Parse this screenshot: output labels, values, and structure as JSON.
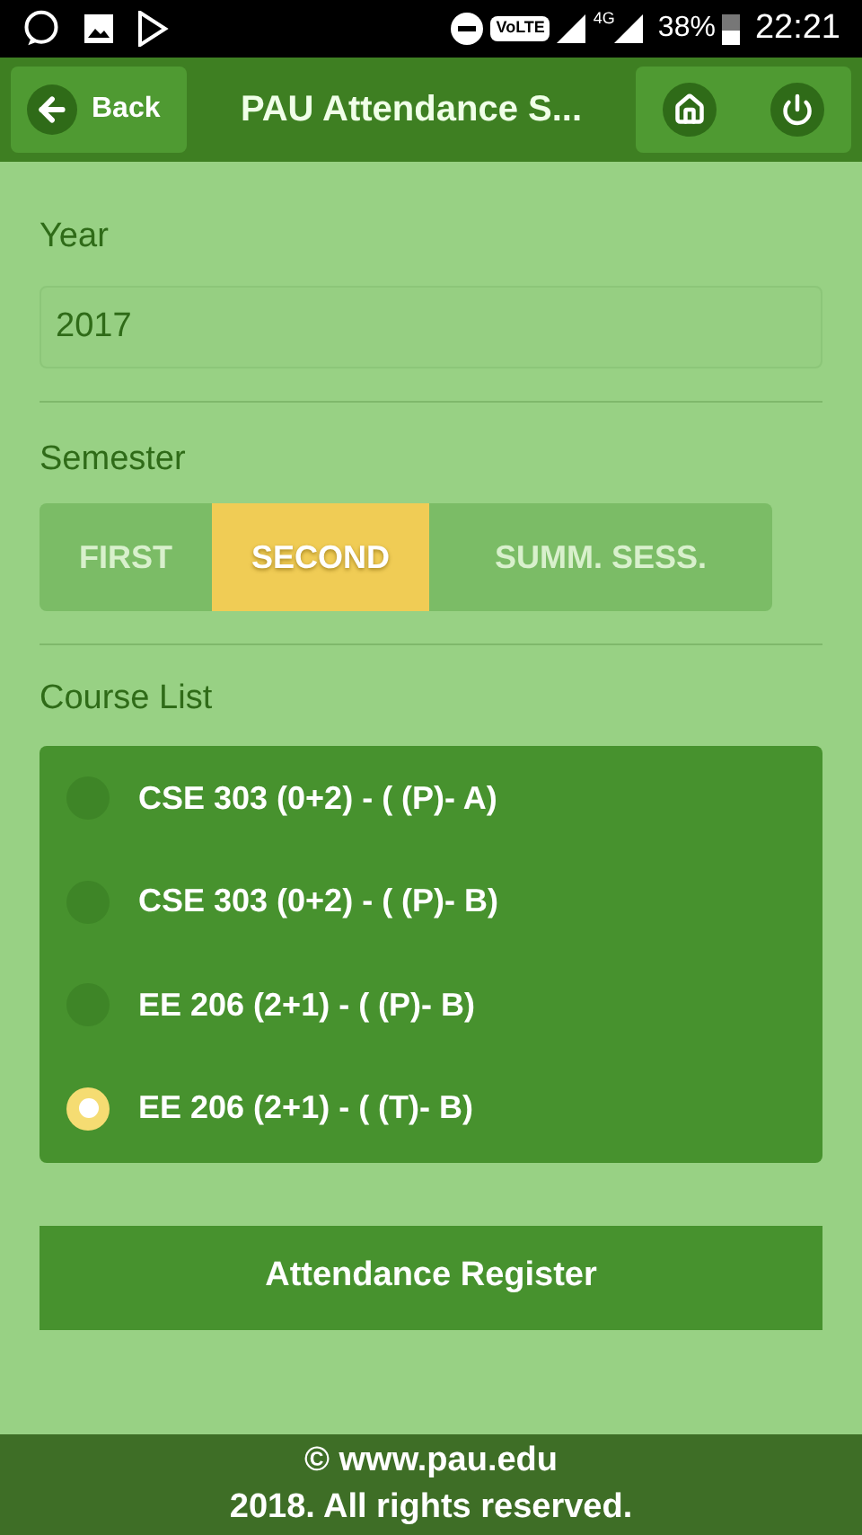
{
  "status_bar": {
    "volte": "VoLTE",
    "network": "4G",
    "battery": "38%",
    "time": "22:21"
  },
  "header": {
    "back": "Back",
    "title": "PAU Attendance S..."
  },
  "year": {
    "label": "Year",
    "value": "2017"
  },
  "semester": {
    "label": "Semester",
    "options": [
      {
        "label": "FIRST",
        "selected": false
      },
      {
        "label": "SECOND",
        "selected": true
      },
      {
        "label": "SUMM. SESS.",
        "selected": false
      }
    ]
  },
  "course_list": {
    "label": "Course List",
    "courses": [
      {
        "label": "CSE 303 (0+2) - ( (P)- A)",
        "selected": false
      },
      {
        "label": "CSE 303 (0+2) - ( (P)- B)",
        "selected": false
      },
      {
        "label": "EE 206 (2+1) - ( (P)- B)",
        "selected": false
      },
      {
        "label": "EE 206 (2+1) - ( (T)- B)",
        "selected": true
      }
    ]
  },
  "submit": "Attendance Register",
  "footer": [
    "© www.pau.edu",
    "2018. All rights reserved."
  ]
}
